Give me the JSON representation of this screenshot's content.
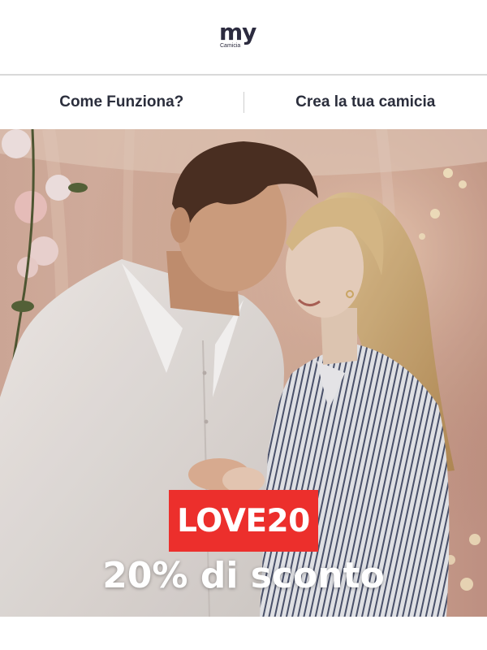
{
  "brand": {
    "logo_text": "my",
    "logo_subtext": "Camicia"
  },
  "nav": {
    "items": [
      {
        "label": "Come Funziona?"
      },
      {
        "label": "Crea la tua camicia"
      }
    ]
  },
  "hero": {
    "promo_code": "LOVE20",
    "promo_text": "20% di sconto"
  },
  "colors": {
    "promo_red": "#ec2f2c",
    "brand_dark": "#2c2b3f",
    "nav_text": "#2b2e3c"
  }
}
